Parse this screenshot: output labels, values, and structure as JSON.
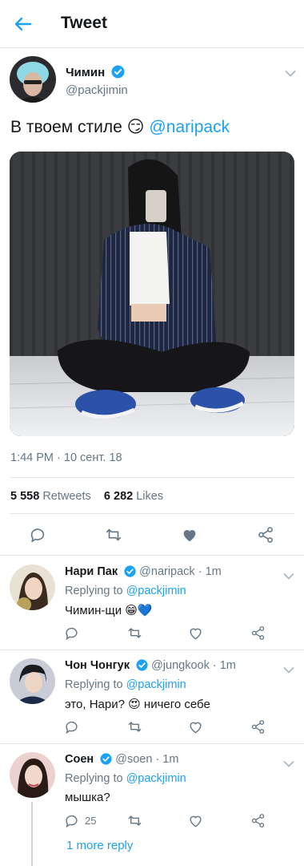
{
  "header": {
    "title": "Tweet",
    "back_icon": "arrow-left-icon"
  },
  "colors": {
    "accent": "#1da1f2",
    "text": "#14171a",
    "muted": "#657786",
    "like_active": "#657786"
  },
  "tweet": {
    "author_name": "Чимин",
    "author_handle": "@packjimin",
    "verified": true,
    "text": "В твоем стиле",
    "emoji": "😏",
    "mention": "@naripack",
    "timestamp": "1:44 PM · 10 сент. 18",
    "retweets_count": "5 558",
    "retweets_label": "Retweets",
    "likes_count": "6 282",
    "likes_label": "Likes",
    "liked": true
  },
  "replies": [
    {
      "name": "Нари Пак",
      "handle": "@naripack",
      "time": "· 1m",
      "replying_label": "Replying to",
      "replying_to": "@packjimin",
      "text": "Чимин-щи 😁💙",
      "reply_count": ""
    },
    {
      "name": "Чон Чонгук",
      "handle": "@jungkook",
      "time": "· 1m",
      "replying_label": "Replying to",
      "replying_to": "@packjimin",
      "text": "это, Нари? 😍 ничего себе",
      "reply_count": ""
    },
    {
      "name": "Соен",
      "handle": "@soen",
      "time": "· 1m",
      "replying_label": "Replying to",
      "replying_to": "@packjimin",
      "text": "мышка?",
      "reply_count": "25",
      "more_replies": "1 more reply"
    }
  ]
}
